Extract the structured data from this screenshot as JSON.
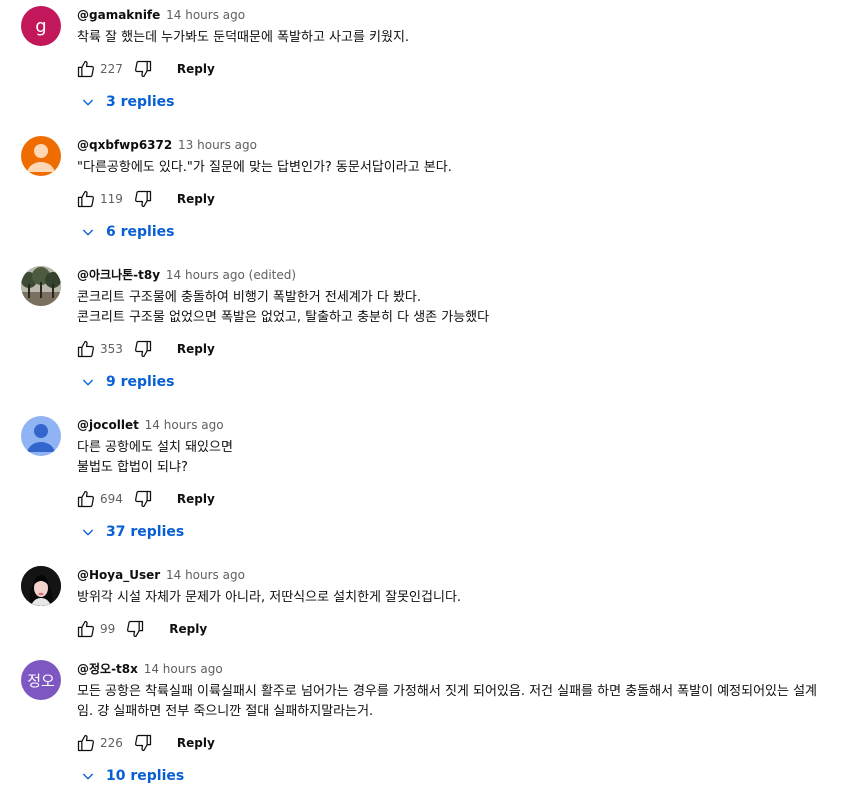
{
  "comments": [
    {
      "author": "@gamaknife",
      "time": "14 hours ago",
      "avatar": {
        "type": "letter",
        "letter": "g",
        "color": "#c2185b"
      },
      "lines": [
        "착륙 잘 했는데 누가봐도 둔덕때문에 폭발하고 사고를 키웠지."
      ],
      "likes": "227",
      "reply_label": "Reply",
      "replies_label": "3 replies"
    },
    {
      "author": "@qxbfwp6372",
      "time": "13 hours ago",
      "avatar": {
        "type": "default",
        "bg": "#ef6c00",
        "fg": "#ffd7b5"
      },
      "lines": [
        "\"다른공항에도 있다.\"가 질문에 맞는 답변인가? 동문서답이라고 본다."
      ],
      "likes": "119",
      "reply_label": "Reply",
      "replies_label": "6 replies"
    },
    {
      "author": "@아크나톤-t8y",
      "time": "14 hours ago (edited)",
      "avatar": {
        "type": "photo-trees"
      },
      "lines": [
        "콘크리트 구조물에 충돌하여 비행기 폭발한거 전세계가 다 봤다.",
        "콘크리트 구조물 없었으면 폭발은 없었고, 탈출하고 충분히 다 생존 가능했다"
      ],
      "likes": "353",
      "reply_label": "Reply",
      "replies_label": "9 replies"
    },
    {
      "author": "@jocollet",
      "time": "14 hours ago",
      "avatar": {
        "type": "default",
        "bg": "#90b4f3",
        "fg": "#3366cc"
      },
      "lines": [
        "다른 공항에도 설치 돼있으면",
        "불법도 합법이 되냐?"
      ],
      "likes": "694",
      "reply_label": "Reply",
      "replies_label": "37 replies"
    },
    {
      "author": "@Hoya_User",
      "time": "14 hours ago",
      "avatar": {
        "type": "photo-person"
      },
      "lines": [
        "방위각 시설 자체가 문제가 아니라, 저딴식으로 설치한게 잘못인겁니다."
      ],
      "likes": "99",
      "reply_label": "Reply",
      "replies_label": ""
    },
    {
      "author": "@정오-t8x",
      "time": "14 hours ago",
      "avatar": {
        "type": "letter",
        "letter": "정오",
        "color": "#7e57c2"
      },
      "lines": [
        "모든 공항은 착륙실패 이륙실패시 활주로 넘어가는 경우를 가정해서 짓게 되어있음. 저건 실패를 하면 충돌해서 폭발이 예정되어있는 설계임. 걍 실패하면 전부 죽으니깐 절대 실패하지말라는거."
      ],
      "likes": "226",
      "reply_label": "Reply",
      "replies_label": "10 replies"
    }
  ]
}
